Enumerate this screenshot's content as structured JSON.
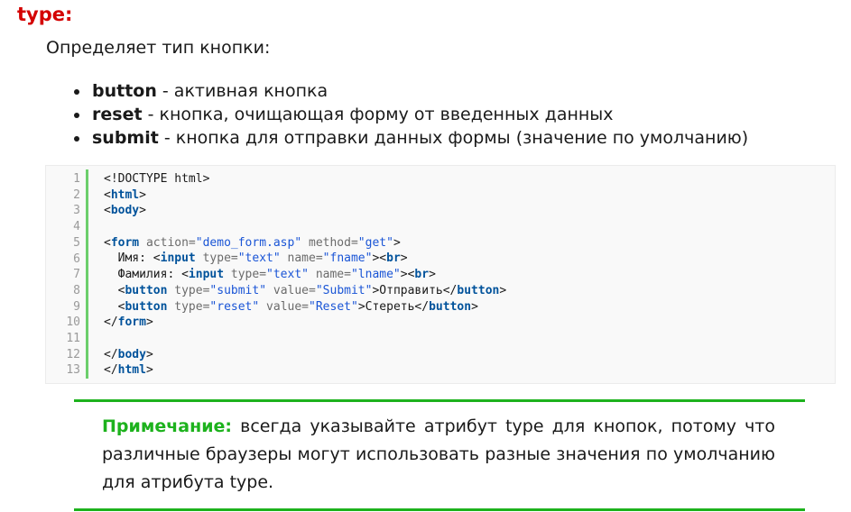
{
  "heading": "type:",
  "intro": "Определяет тип кнопки:",
  "types": [
    {
      "name": "button",
      "desc": " - активная кнопка"
    },
    {
      "name": "reset",
      "desc": " - кнопка, очищающая форму от введенных данных"
    },
    {
      "name": "submit",
      "desc": " - кнопка для отправки данных формы (значение по умолчанию)"
    }
  ],
  "code": {
    "line_numbers": [
      "1",
      "2",
      "3",
      "4",
      "5",
      "6",
      "7",
      "8",
      "9",
      "10",
      "11",
      "12",
      "13"
    ],
    "lines": [
      [
        {
          "t": "text",
          "v": "<!DOCTYPE html>"
        }
      ],
      [
        {
          "t": "text",
          "v": "<"
        },
        {
          "t": "tag",
          "v": "html"
        },
        {
          "t": "text",
          "v": ">"
        }
      ],
      [
        {
          "t": "text",
          "v": "<"
        },
        {
          "t": "tag",
          "v": "body"
        },
        {
          "t": "text",
          "v": ">"
        }
      ],
      [],
      [
        {
          "t": "text",
          "v": "<"
        },
        {
          "t": "tag",
          "v": "form"
        },
        {
          "t": "text",
          "v": " "
        },
        {
          "t": "attr",
          "v": "action="
        },
        {
          "t": "val",
          "v": "\"demo_form.asp\""
        },
        {
          "t": "text",
          "v": " "
        },
        {
          "t": "attr",
          "v": "method="
        },
        {
          "t": "val",
          "v": "\"get\""
        },
        {
          "t": "text",
          "v": ">"
        }
      ],
      [
        {
          "t": "text",
          "v": "  Имя: <"
        },
        {
          "t": "tag",
          "v": "input"
        },
        {
          "t": "text",
          "v": " "
        },
        {
          "t": "attr",
          "v": "type="
        },
        {
          "t": "val",
          "v": "\"text\""
        },
        {
          "t": "text",
          "v": " "
        },
        {
          "t": "attr",
          "v": "name="
        },
        {
          "t": "val",
          "v": "\"fname\""
        },
        {
          "t": "text",
          "v": "><"
        },
        {
          "t": "tag",
          "v": "br"
        },
        {
          "t": "text",
          "v": ">"
        }
      ],
      [
        {
          "t": "text",
          "v": "  Фамилия: <"
        },
        {
          "t": "tag",
          "v": "input"
        },
        {
          "t": "text",
          "v": " "
        },
        {
          "t": "attr",
          "v": "type="
        },
        {
          "t": "val",
          "v": "\"text\""
        },
        {
          "t": "text",
          "v": " "
        },
        {
          "t": "attr",
          "v": "name="
        },
        {
          "t": "val",
          "v": "\"lname\""
        },
        {
          "t": "text",
          "v": "><"
        },
        {
          "t": "tag",
          "v": "br"
        },
        {
          "t": "text",
          "v": ">"
        }
      ],
      [
        {
          "t": "text",
          "v": "  <"
        },
        {
          "t": "tag",
          "v": "button"
        },
        {
          "t": "text",
          "v": " "
        },
        {
          "t": "attr",
          "v": "type="
        },
        {
          "t": "val",
          "v": "\"submit\""
        },
        {
          "t": "text",
          "v": " "
        },
        {
          "t": "attr",
          "v": "value="
        },
        {
          "t": "val",
          "v": "\"Submit\""
        },
        {
          "t": "text",
          "v": ">Отправить</"
        },
        {
          "t": "tag",
          "v": "button"
        },
        {
          "t": "text",
          "v": ">"
        }
      ],
      [
        {
          "t": "text",
          "v": "  <"
        },
        {
          "t": "tag",
          "v": "button"
        },
        {
          "t": "text",
          "v": " "
        },
        {
          "t": "attr",
          "v": "type="
        },
        {
          "t": "val",
          "v": "\"reset\""
        },
        {
          "t": "text",
          "v": " "
        },
        {
          "t": "attr",
          "v": "value="
        },
        {
          "t": "val",
          "v": "\"Reset\""
        },
        {
          "t": "text",
          "v": ">Стереть</"
        },
        {
          "t": "tag",
          "v": "button"
        },
        {
          "t": "text",
          "v": ">"
        }
      ],
      [
        {
          "t": "text",
          "v": "</"
        },
        {
          "t": "tag",
          "v": "form"
        },
        {
          "t": "text",
          "v": ">"
        }
      ],
      [],
      [
        {
          "t": "text",
          "v": "</"
        },
        {
          "t": "tag",
          "v": "body"
        },
        {
          "t": "text",
          "v": ">"
        }
      ],
      [
        {
          "t": "text",
          "v": "</"
        },
        {
          "t": "tag",
          "v": "html"
        },
        {
          "t": "text",
          "v": ">"
        }
      ]
    ]
  },
  "note": {
    "label": "Примечание:",
    "text": " всегда указывайте атрибут type для кнопок, потому что различные браузеры могут использовать разные значения по умолчанию для атрибута type."
  },
  "colors": {
    "heading": "#d40000",
    "note_accent": "#1db21d",
    "code_tag": "#00529b",
    "code_value": "#1a55d6"
  }
}
